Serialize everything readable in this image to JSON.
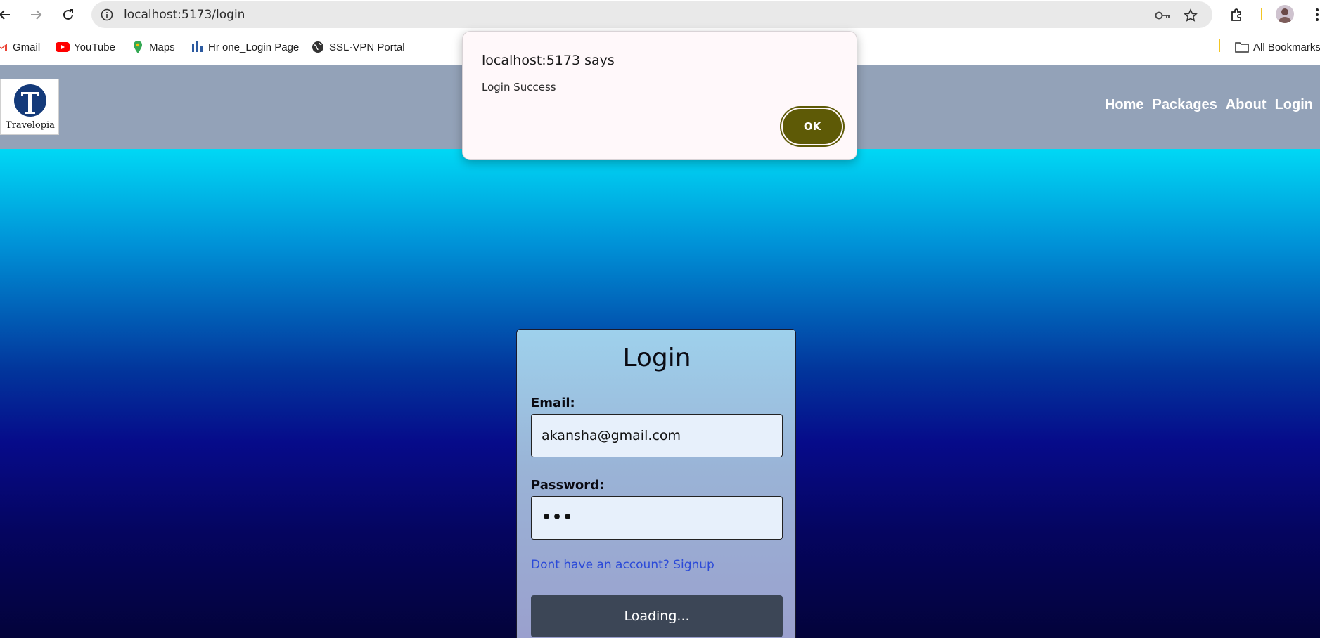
{
  "browser": {
    "url": "localhost:5173/login",
    "bookmarks": [
      "Gmail",
      "YouTube",
      "Maps",
      "Hr one_Login Page",
      "SSL-VPN Portal"
    ],
    "all_bookmarks": "All Bookmarks"
  },
  "site": {
    "logo_text": "Travelopia",
    "nav": [
      "Home",
      "Packages",
      "About",
      "Login"
    ]
  },
  "login": {
    "title": "Login",
    "email_label": "Email:",
    "email_value": "akansha@gmail.com",
    "password_label": "Password:",
    "password_value": "•••",
    "signup_link": "Dont have an account? Signup",
    "submit_label": "Loading..."
  },
  "dialog": {
    "title": "localhost:5173 says",
    "message": "Login Success",
    "ok_label": "OK"
  },
  "colors": {
    "header_bg": "#93a2b8",
    "ok_button": "#5e5a06",
    "submit_button": "#3c4656",
    "link": "#2b4ad8"
  },
  "icons": {
    "back": "back-arrow-icon",
    "forward": "forward-arrow-icon",
    "reload": "reload-icon",
    "info": "site-info-icon",
    "key": "password-key-icon",
    "star": "bookmark-star-icon",
    "extensions": "extensions-icon",
    "menu": "kebab-menu-icon",
    "folder": "folder-icon"
  }
}
